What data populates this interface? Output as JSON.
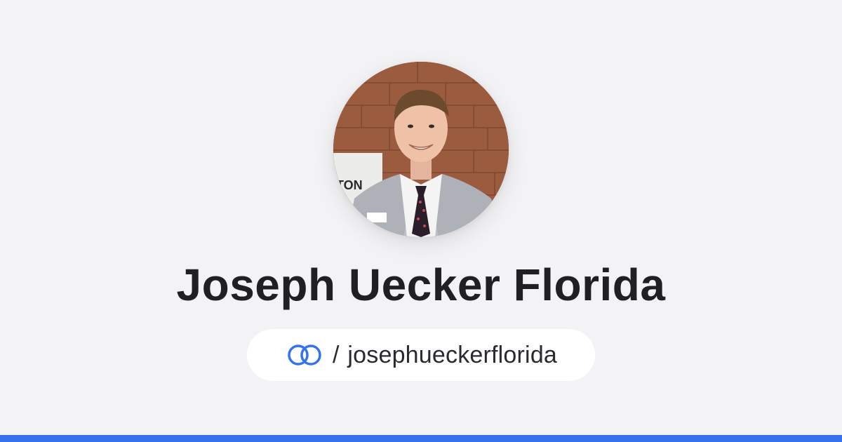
{
  "profile": {
    "name": "Joseph Uecker Florida",
    "handle_separator": "/",
    "handle": "josephueckerflorida",
    "avatar_alt": "profile photo"
  },
  "icons": {
    "link": "linked-rings-icon"
  },
  "colors": {
    "background": "#f3f3f6",
    "accent": "#3573ec",
    "text": "#1f1f24"
  }
}
